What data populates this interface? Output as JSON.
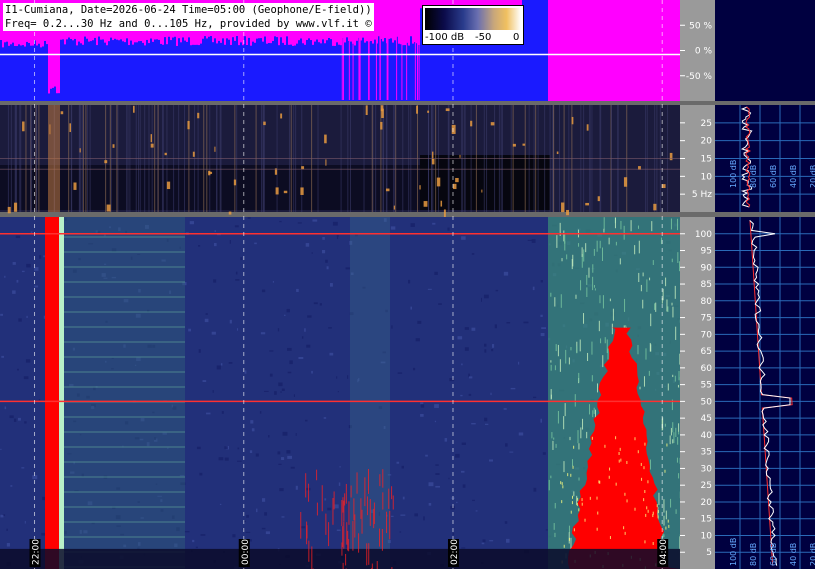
{
  "header": {
    "title": "I1-Cumiana, Date=2026-06-24 Time=05:00 (Geophone/E-field))",
    "freq": "Freq= 0.2...30 Hz and 0...105 Hz, provided by www.vlf.it ©"
  },
  "colorbar": {
    "labels": [
      "-100 dB",
      "-50",
      "0"
    ]
  },
  "chart_data": [
    {
      "type": "area",
      "panel": "amplitude",
      "ylabel": "",
      "y_ticks": [
        "50 %",
        "0 %",
        "-50 %"
      ],
      "y_range": [
        -100,
        100
      ],
      "colors": {
        "background": "#ff00ff",
        "fill": "#1a1aff",
        "trace": "#ffffff"
      }
    },
    {
      "type": "heatmap",
      "panel": "low-frequency spectrogram",
      "y_range": [
        0,
        30
      ],
      "y_ticks": [
        "25",
        "20",
        "15",
        "10",
        "5 Hz"
      ],
      "y_tick_values": [
        25,
        20,
        15,
        10,
        5
      ],
      "profile_ticks": [
        "100 dB",
        "80 dB",
        "60 dB",
        "40 dB",
        "20 dB"
      ]
    },
    {
      "type": "heatmap",
      "panel": "main spectrogram",
      "y_range": [
        0,
        105
      ],
      "y_ticks": [
        "100",
        "95",
        "90",
        "85",
        "80",
        "75",
        "70",
        "65",
        "60",
        "55",
        "50",
        "45",
        "40",
        "35",
        "30",
        "25",
        "20",
        "15",
        "10",
        "5"
      ],
      "y_tick_values": [
        100,
        95,
        90,
        85,
        80,
        75,
        70,
        65,
        60,
        55,
        50,
        45,
        40,
        35,
        30,
        25,
        20,
        15,
        10,
        5
      ],
      "x_range_hours": [
        21.67,
        28.17
      ],
      "time_ticks": [
        "22:00",
        "00:00",
        "02:00",
        "04:00"
      ],
      "time_tick_hours": [
        22,
        24,
        26,
        28
      ],
      "profile_ticks": [
        "100 dB",
        "80 dB",
        "60 dB",
        "40 dB",
        "20 dB"
      ],
      "lines_hz": [
        50,
        100
      ]
    }
  ]
}
